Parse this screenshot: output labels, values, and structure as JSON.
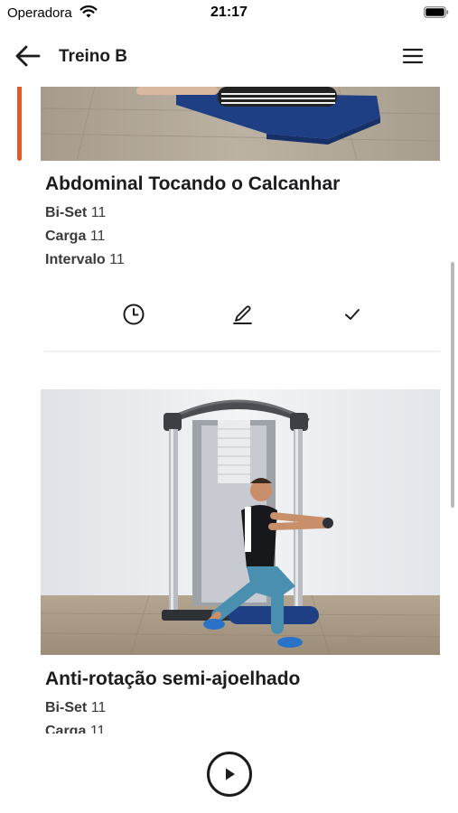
{
  "status": {
    "carrier": "Operadora",
    "time": "21:17"
  },
  "header": {
    "title": "Treino B"
  },
  "exercises": [
    {
      "name": "Abdominal Tocando o Calcanhar",
      "rows": [
        {
          "label": "Bi-Set",
          "value": "11"
        },
        {
          "label": "Carga",
          "value": "11"
        },
        {
          "label": "Intervalo",
          "value": "11"
        }
      ]
    },
    {
      "name": "Anti-rotação semi-ajoelhado",
      "rows": [
        {
          "label": "Bi-Set",
          "value": "11"
        },
        {
          "label": "Carga",
          "value": "11"
        }
      ]
    }
  ],
  "colors": {
    "accent": "#e8572a",
    "text": "#1c1c1e"
  },
  "icons": [
    "wifi-icon",
    "battery-icon",
    "back-arrow-icon",
    "hamburger-menu-icon",
    "clock-icon",
    "pencil-icon",
    "checkmark-icon",
    "play-icon"
  ]
}
